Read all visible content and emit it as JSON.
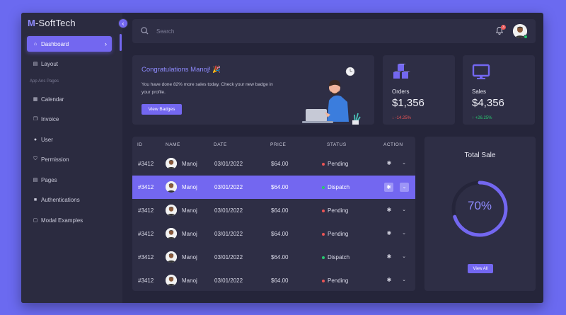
{
  "brand": {
    "initial": "M",
    "rest": "-SoftTech"
  },
  "sidebar": {
    "items": [
      {
        "label": "Dashboard",
        "icon": "home-icon"
      },
      {
        "label": "Layout",
        "icon": "file-icon"
      },
      {
        "label": "Calendar",
        "icon": "calendar-icon"
      },
      {
        "label": "Invoice",
        "icon": "copy-icon"
      },
      {
        "label": "User",
        "icon": "user-icon"
      },
      {
        "label": "Permission",
        "icon": "shield-icon"
      },
      {
        "label": "Pages",
        "icon": "file-icon"
      },
      {
        "label": "Authentications",
        "icon": "lock-icon"
      },
      {
        "label": "Modal Examples",
        "icon": "square-icon"
      }
    ],
    "section_label": "App Ans Pages"
  },
  "search": {
    "placeholder": "Search"
  },
  "notifications": {
    "count": "3"
  },
  "congrats": {
    "title": "Congratulations Manoj! 🎉",
    "text": "You have done 82% more sales today. Check your new badge in your profile.",
    "button": "View Badges"
  },
  "stats": {
    "orders": {
      "label": "Orders",
      "value": "$1,356",
      "change": "↓ -14.25%"
    },
    "sales": {
      "label": "Sales",
      "value": "$4,356",
      "change": "↑ +26.25%"
    }
  },
  "table": {
    "headers": [
      "ID",
      "NAME",
      "DATE",
      "PRICE",
      "STATUS",
      "ACTION"
    ],
    "rows": [
      {
        "id": "#3412",
        "name": "Manoj",
        "date": "03/01/2022",
        "price": "$64.00",
        "status": "Pending"
      },
      {
        "id": "#3412",
        "name": "Manoj",
        "date": "03/01/2022",
        "price": "$64.00",
        "status": "Dispatch"
      },
      {
        "id": "#3412",
        "name": "Manoj",
        "date": "03/01/2022",
        "price": "$64.00",
        "status": "Pending"
      },
      {
        "id": "#3412",
        "name": "Manoj",
        "date": "03/01/2022",
        "price": "$64.00",
        "status": "Pending"
      },
      {
        "id": "#3412",
        "name": "Manoj",
        "date": "03/01/2022",
        "price": "$64.00",
        "status": "Dispatch"
      },
      {
        "id": "#3412",
        "name": "Manoj",
        "date": "03/01/2022",
        "price": "$64.00",
        "status": "Pending"
      }
    ]
  },
  "total_sale": {
    "title": "Total Sale",
    "percent": "70%",
    "fraction": 0.7,
    "button": "View All"
  },
  "colors": {
    "accent": "#7367f0",
    "pending": "#ea5455",
    "dispatch": "#28c76f"
  }
}
